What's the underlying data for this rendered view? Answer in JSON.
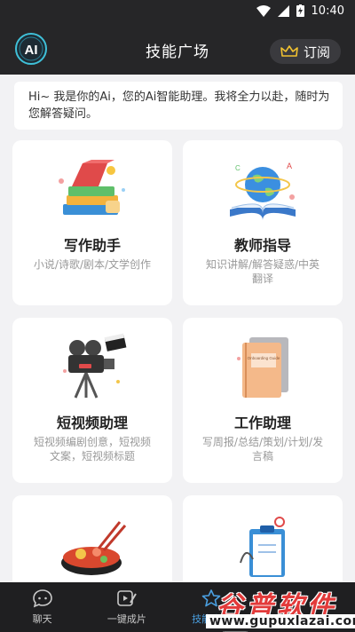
{
  "status_bar": {
    "time": "10:40"
  },
  "header": {
    "logo_text": "AI",
    "title": "技能广场",
    "subscribe_label": "订阅"
  },
  "greeting": "Hi~ 我是你的Ai，您的Ai智能助理。我将全力以赴，随时为您解答疑问。",
  "cards": [
    {
      "title": "写作助手",
      "desc": "小说/诗歌/剧本/文学创作",
      "icon": "books-icon"
    },
    {
      "title": "教师指导",
      "desc": "知识讲解/解答疑惑/中英翻译",
      "icon": "globe-book-icon"
    },
    {
      "title": "短视频助理",
      "desc": "短视频编剧创意，短视频文案，短视频标题",
      "icon": "movie-camera-icon"
    },
    {
      "title": "工作助理",
      "desc": "写周报/总结/策划/计划/发言稿",
      "icon": "notebook-icon",
      "illus_text": "Onboarding Guide"
    },
    {
      "title": "",
      "desc": "",
      "icon": "food-bowl-icon"
    },
    {
      "title": "",
      "desc": "",
      "icon": "medical-clipboard-icon"
    }
  ],
  "nav": [
    {
      "label": "聊天",
      "icon": "chat-icon"
    },
    {
      "label": "一键成片",
      "icon": "video-edit-icon"
    },
    {
      "label": "技能广场",
      "icon": "star-icon",
      "active": true
    }
  ],
  "watermark": {
    "main": "谷普软件园",
    "url": "www.gupuxlazai.com"
  },
  "colors": {
    "accent": "#4a9fe0",
    "header_bg": "#262628",
    "content_bg": "#f2f2f4"
  }
}
